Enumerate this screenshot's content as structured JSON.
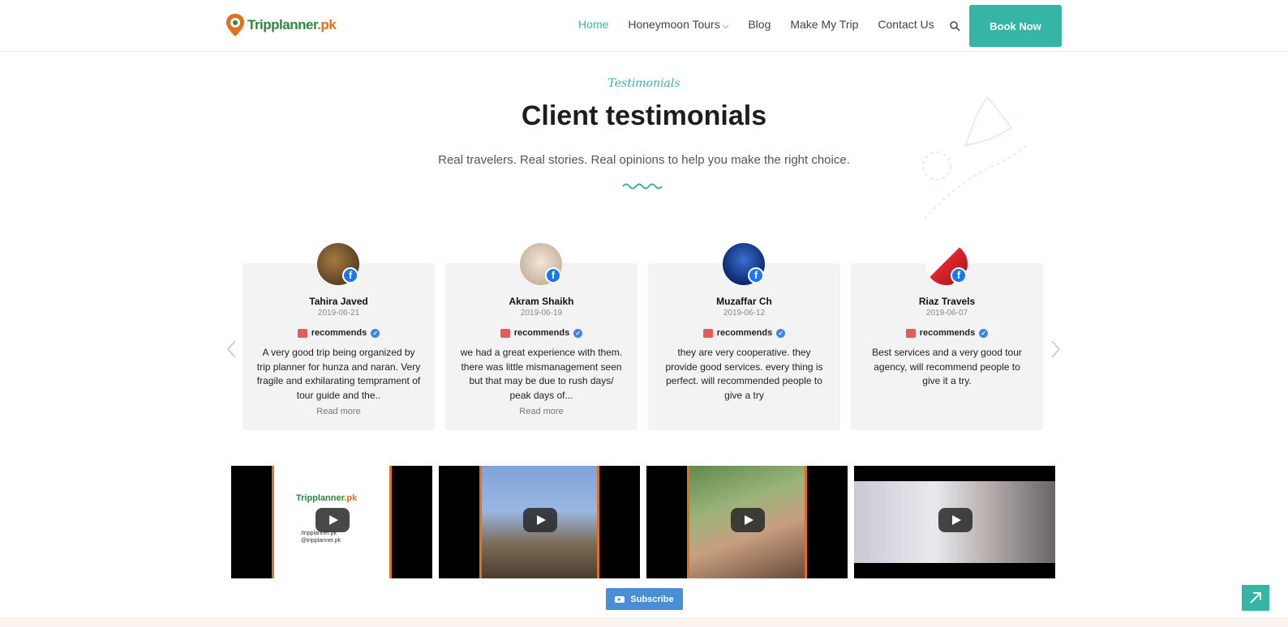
{
  "header": {
    "logo": {
      "part1": "Tripplanner",
      "part2": ".pk"
    },
    "nav": [
      {
        "label": "Home",
        "active": true
      },
      {
        "label": "Honeymoon Tours",
        "has_dropdown": true
      },
      {
        "label": "Blog"
      },
      {
        "label": "Make My Trip"
      },
      {
        "label": "Contact Us"
      }
    ],
    "book_now": "Book Now"
  },
  "section": {
    "eyebrow": "Testimonials",
    "title": "Client testimonials",
    "subtitle": "Real travelers. Real stories. Real opinions to help you make the right choice."
  },
  "testimonials": [
    {
      "name": "Tahira Javed",
      "date": "2019-06-21",
      "badge": "recommends",
      "text": "A very good trip being organized by trip planner for hunza and naran. Very fragile and exhilarating temprament of tour guide and the..",
      "read_more": "Read more"
    },
    {
      "name": "Akram Shaikh",
      "date": "2019-06-19",
      "badge": "recommends",
      "text": "we had a great experience with them. there was little mismanagement seen but that may be due to rush days/ peak days of...",
      "read_more": "Read more"
    },
    {
      "name": "Muzaffar Ch",
      "date": "2019-06-12",
      "badge": "recommends",
      "text": "they are very cooperative. they provide good services. every thing is perfect. will recommended people to give a try"
    },
    {
      "name": "Riaz Travels",
      "date": "2019-06-07",
      "badge": "recommends",
      "text": "Best services and a very good tour agency, will recommend people to give it a try."
    }
  ],
  "video1_overlay": {
    "logo_part1": "Tripplanner",
    "logo_part2": ".pk",
    "line2": "/tripplanner.pk",
    "line3": "@tripplanner.pk"
  },
  "subscribe": "Subscribe",
  "colors": {
    "accent": "#35b6a5",
    "facebook": "#1877f2",
    "subscribe": "#4a8ed6"
  }
}
